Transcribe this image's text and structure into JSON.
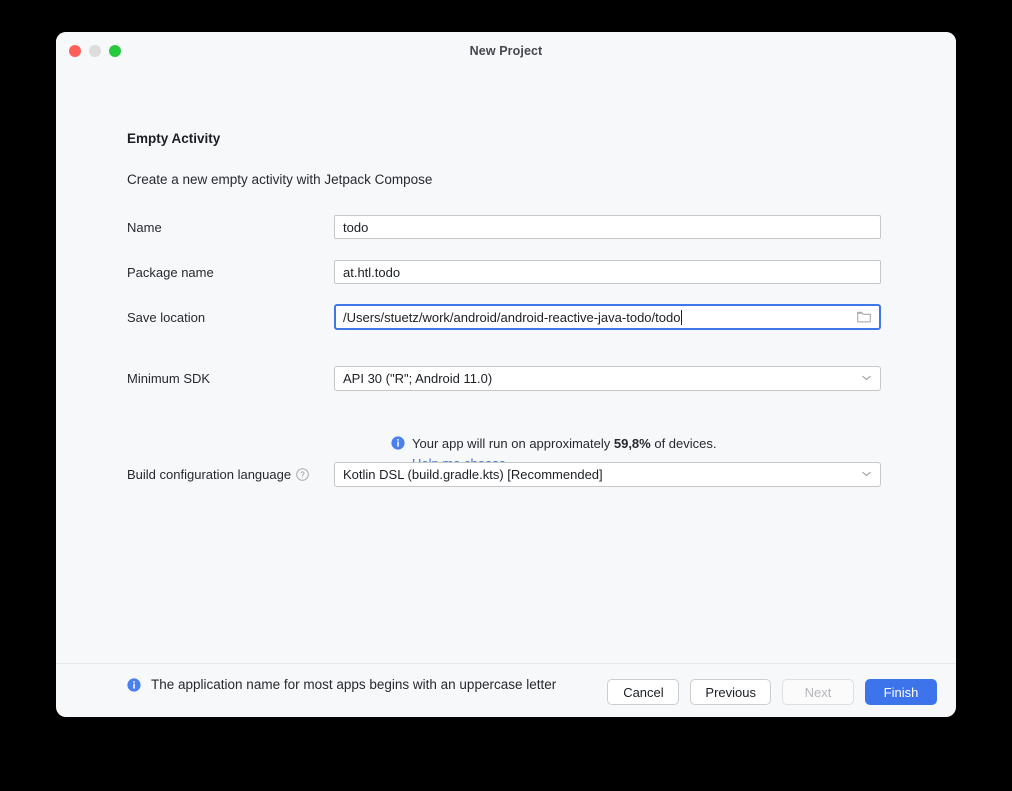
{
  "window": {
    "title": "New Project",
    "traffic_lights": [
      {
        "name": "close-button"
      },
      {
        "name": "minimize-button"
      },
      {
        "name": "zoom-button"
      }
    ]
  },
  "page": {
    "heading": "Empty Activity",
    "subheading": "Create a new empty activity with Jetpack Compose"
  },
  "fields": {
    "name": {
      "label": "Name",
      "value": "todo"
    },
    "package_name": {
      "label": "Package name",
      "value": "at.htl.todo"
    },
    "save_location": {
      "label": "Save location",
      "value": "/Users/stuetz/work/android/android-reactive-java-todo/todo",
      "browse_icon": "folder-icon",
      "focused": true
    },
    "minimum_sdk": {
      "label": "Minimum SDK",
      "value": "API 30 (\"R\"; Android 11.0)",
      "dropdown_icon": "chevron-down-icon"
    },
    "build_configuration_language": {
      "label": "Build configuration language",
      "help_icon": "question-mark-icon",
      "value": "Kotlin DSL (build.gradle.kts) [Recommended]",
      "dropdown_icon": "chevron-down-icon"
    }
  },
  "sdk_info": {
    "icon": "info-icon",
    "text_before": "Your app will run on approximately ",
    "percentage": "59,8%",
    "text_after": " of devices.",
    "help_link": "Help me choose"
  },
  "footer_note": {
    "icon": "info-icon",
    "text": "The application name for most apps begins with an uppercase letter"
  },
  "buttons": [
    {
      "label": "Cancel",
      "name": "cancel-button",
      "state": "enabled"
    },
    {
      "label": "Previous",
      "name": "previous-button",
      "state": "enabled"
    },
    {
      "label": "Next",
      "name": "next-button",
      "state": "disabled"
    },
    {
      "label": "Finish",
      "name": "finish-button",
      "state": "primary"
    }
  ],
  "colors": {
    "accent": "#3d74ec",
    "link": "#3d6fd4",
    "focus_border": "#3f76e8",
    "dialog_bg": "#f7f8fa",
    "close": "#ff5f57",
    "minimize": "#dcdcdc",
    "zoom": "#27c93f"
  }
}
